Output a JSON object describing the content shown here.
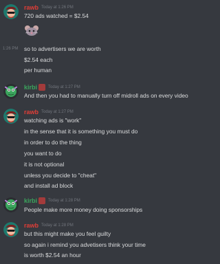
{
  "colors": {
    "background": "#36393f",
    "rawb_name": "#e03e37",
    "kirbi_name": "#3ba55d",
    "timestamp": "#72767d",
    "text": "#dcddde"
  },
  "messages": [
    {
      "author": "rawb",
      "time": "Today at 1:26 PM",
      "lines": [
        "720 ads watched = $2.54"
      ]
    },
    {
      "side_time": "1:26 PM",
      "lines": [
        "so to advertisers we are worth",
        "$2.54 each",
        "per human"
      ]
    },
    {
      "author": "kirbi",
      "time": "Today at 1:27 PM",
      "lines": [
        "And then you had to manually turn off midroll ads on every video"
      ]
    },
    {
      "author": "rawb",
      "time": "Today at 1:27 PM",
      "lines": [
        "watching ads is \"work\"",
        "in the sense that it is something you must do",
        "in order to do the thing",
        "you want to do",
        "it is not optional",
        "unless you decide to \"cheat\"",
        "and install ad block"
      ]
    },
    {
      "author": "kirbi",
      "time": "Today at 1:28 PM",
      "lines": [
        "People make more money doing sponsorships"
      ]
    },
    {
      "author": "rawb",
      "time": "Today at 1:28 PM",
      "lines": [
        "but this might make you feel guilty",
        "so again i remind you advetisers think your time",
        "is worth $2.54 an hour"
      ]
    }
  ]
}
